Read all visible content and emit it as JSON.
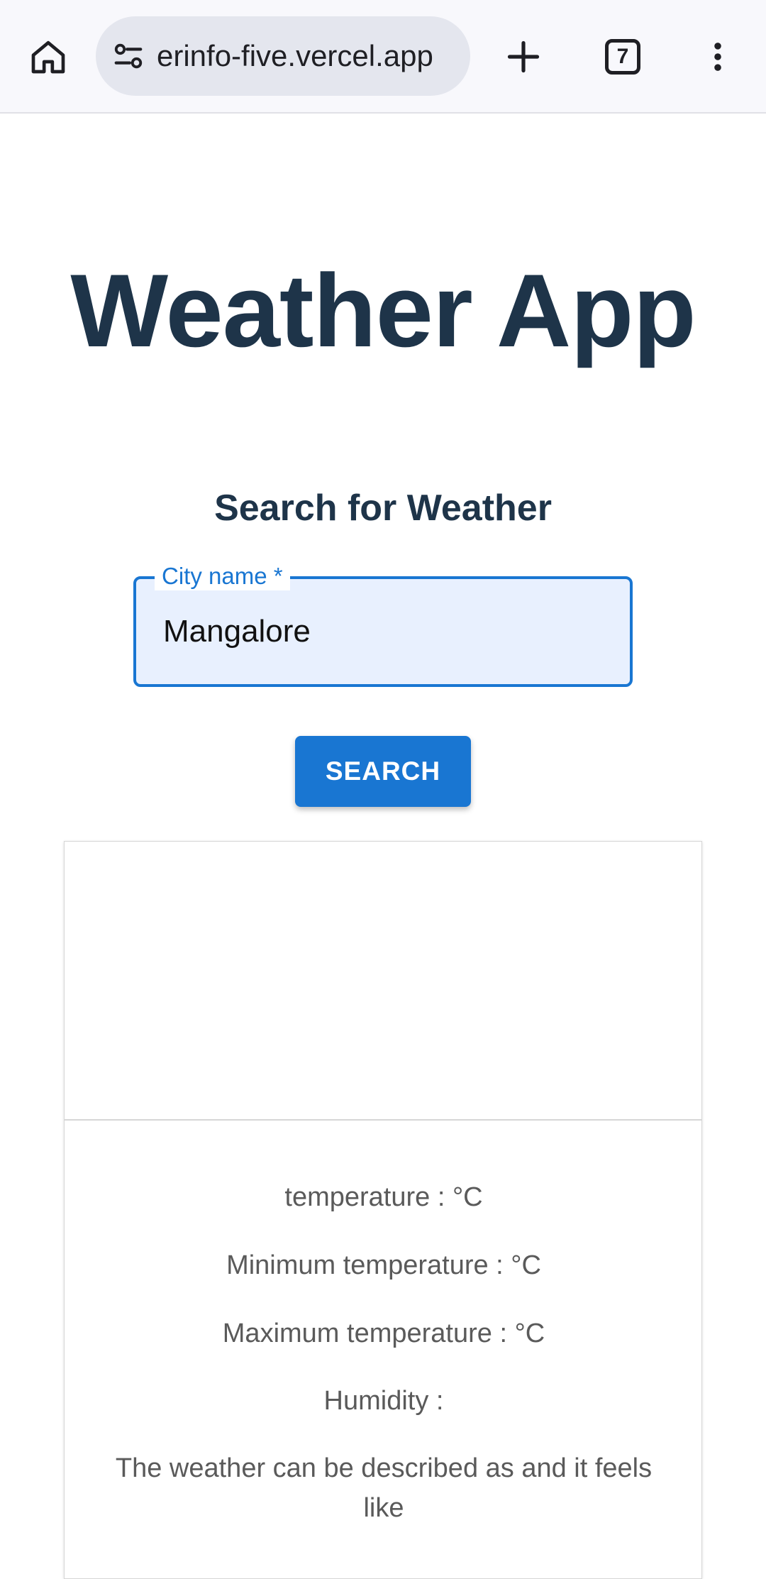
{
  "browser": {
    "url": "erinfo-five.vercel.app",
    "tab_count": "7"
  },
  "page": {
    "title": "Weather App",
    "section_title": "Search for Weather"
  },
  "search": {
    "label": "City name *",
    "value": "Mangalore",
    "button_label": "SEARCH"
  },
  "weather": {
    "temperature": "temperature : °C",
    "min_temperature": "Minimum temperature : °C",
    "max_temperature": "Maximum temperature : °C",
    "humidity": "Humidity :",
    "description": "The weather can be described as and it feels like"
  },
  "colors": {
    "accent": "#1976d2",
    "heading": "#1e3449",
    "field_bg": "#e8f0fe"
  }
}
